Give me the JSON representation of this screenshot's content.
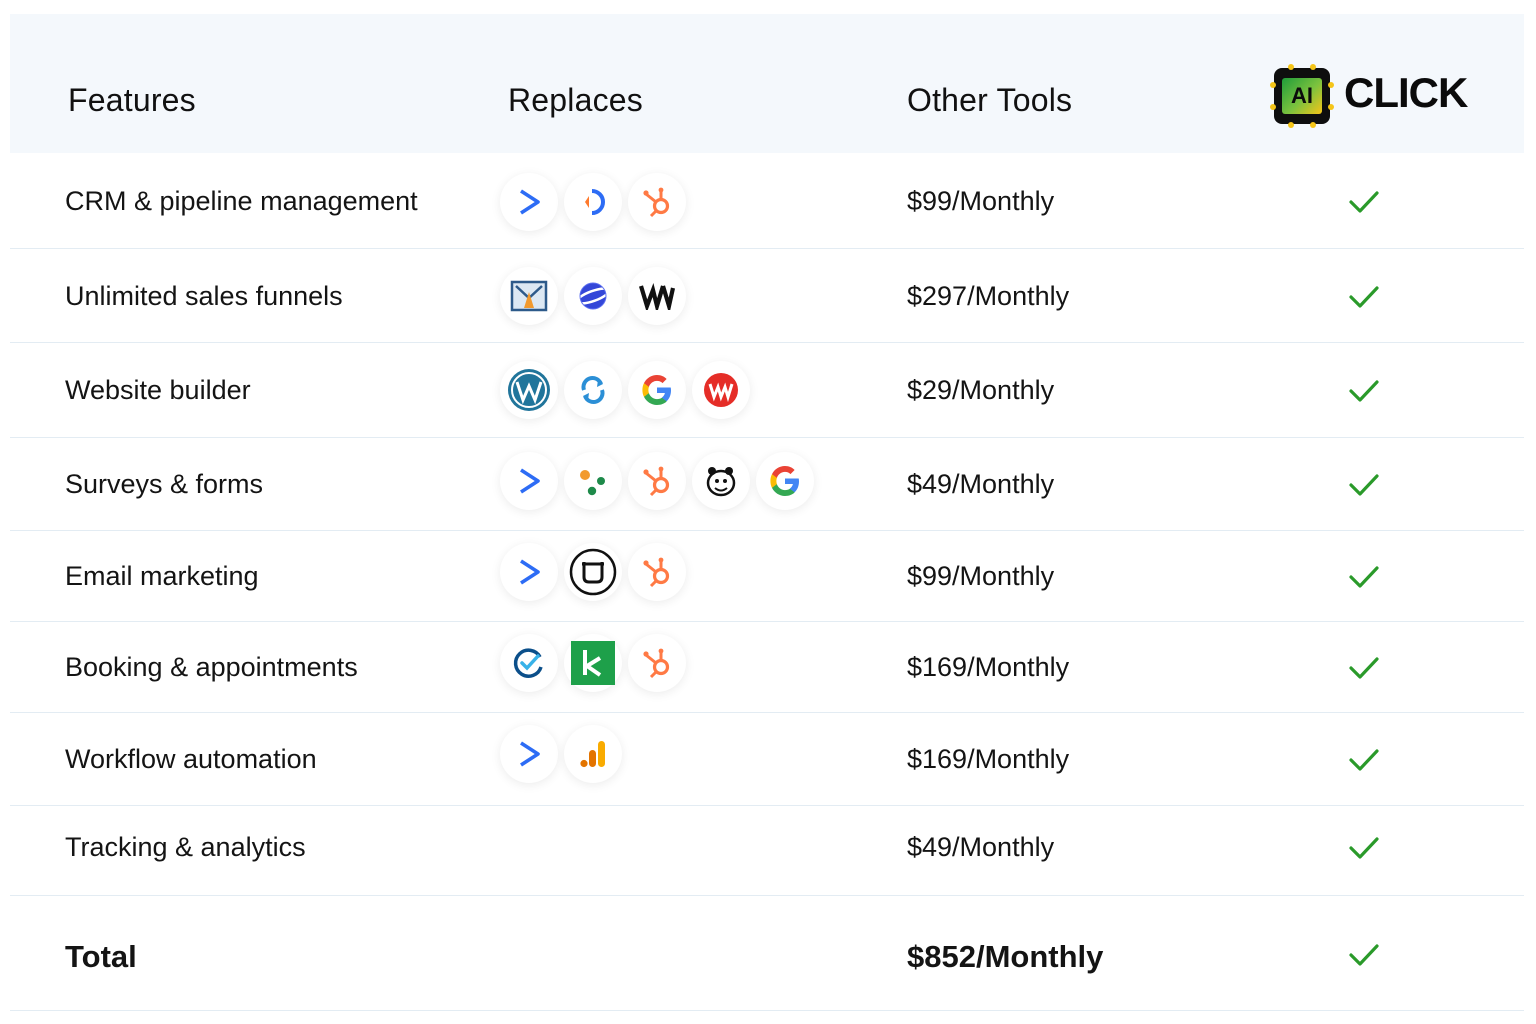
{
  "header": {
    "features": "Features",
    "replaces": "Replaces",
    "other_tools": "Other Tools",
    "brand_chip": "AI",
    "brand_name": "CLICK"
  },
  "rows": [
    {
      "feature": "CRM & pipeline management",
      "price": "$99/Monthly",
      "icons": [
        "activecampaign-icon",
        "pipedrive-icon",
        "hubspot-icon"
      ]
    },
    {
      "feature": "Unlimited sales funnels",
      "price": "$297/Monthly",
      "icons": [
        "clickfunnels-icon",
        "planet-icon",
        "wix-icon"
      ]
    },
    {
      "feature": "Website builder",
      "price": "$29/Monthly",
      "icons": [
        "wordpress-icon",
        "sync-icon",
        "google-icon",
        "webflow-icon"
      ]
    },
    {
      "feature": "Surveys & forms",
      "price": "$49/Monthly",
      "icons": [
        "activecampaign-icon",
        "dots-icon",
        "hubspot-icon",
        "mailchimp-icon",
        "google-icon"
      ]
    },
    {
      "feature": "Email marketing",
      "price": "$99/Monthly",
      "icons": [
        "activecampaign-icon",
        "box-icon",
        "hubspot-icon"
      ]
    },
    {
      "feature": "Booking & appointments",
      "price": "$169/Monthly",
      "icons": [
        "calendly-icon",
        "kajabi-icon",
        "hubspot-icon"
      ]
    },
    {
      "feature": "Workflow automation",
      "price": "$169/Monthly",
      "icons": [
        "activecampaign-icon",
        "analytics-icon"
      ]
    },
    {
      "feature": "Tracking & analytics",
      "price": "$49/Monthly",
      "icons": []
    }
  ],
  "total": {
    "label": "Total",
    "price": "$852/Monthly"
  },
  "colors": {
    "check": "#2a9a2a",
    "header_bg": "#f4f8fc",
    "divider": "#e3ecf3"
  }
}
